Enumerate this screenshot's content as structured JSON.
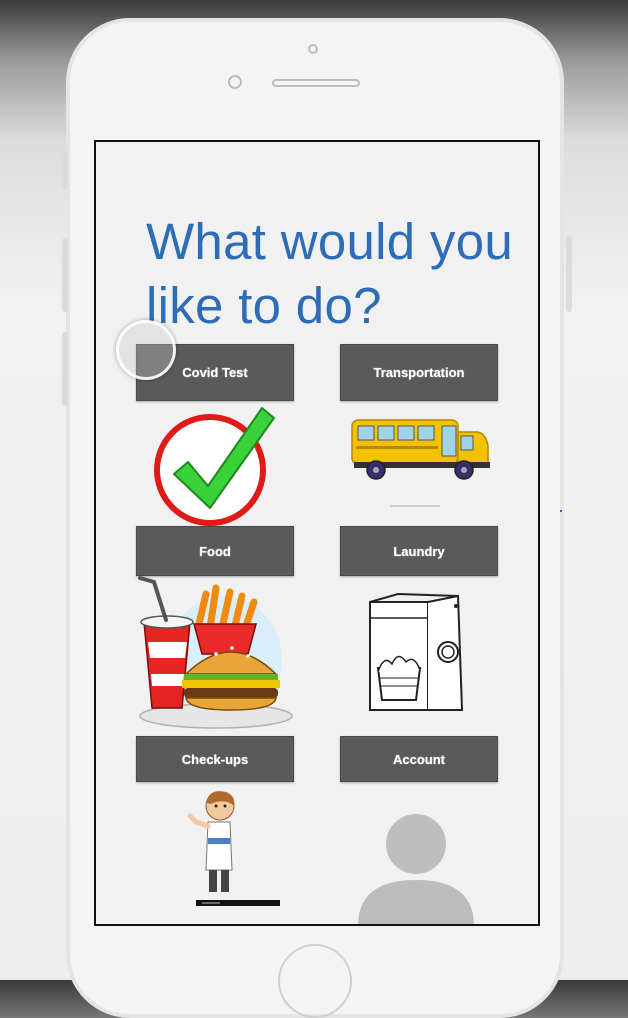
{
  "screen": {
    "title": "What would you like to do?",
    "options": [
      {
        "label": "Covid Test",
        "icon": "checkmark-icon"
      },
      {
        "label": "Transportation",
        "icon": "school-bus-icon"
      },
      {
        "label": "Food",
        "icon": "fast-food-icon"
      },
      {
        "label": "Laundry",
        "icon": "washing-machine-icon"
      },
      {
        "label": "Check-ups",
        "icon": "doctor-icon"
      },
      {
        "label": "Account",
        "icon": "user-avatar-icon"
      }
    ]
  },
  "colors": {
    "title": "#2e6cb8",
    "button": "#5a5a5a",
    "button_text": "#ffffff",
    "check_green": "#3ad13a",
    "check_circle": "#e01919",
    "bus_yellow": "#f2c200",
    "avatar_gray": "#bdbdbd"
  }
}
